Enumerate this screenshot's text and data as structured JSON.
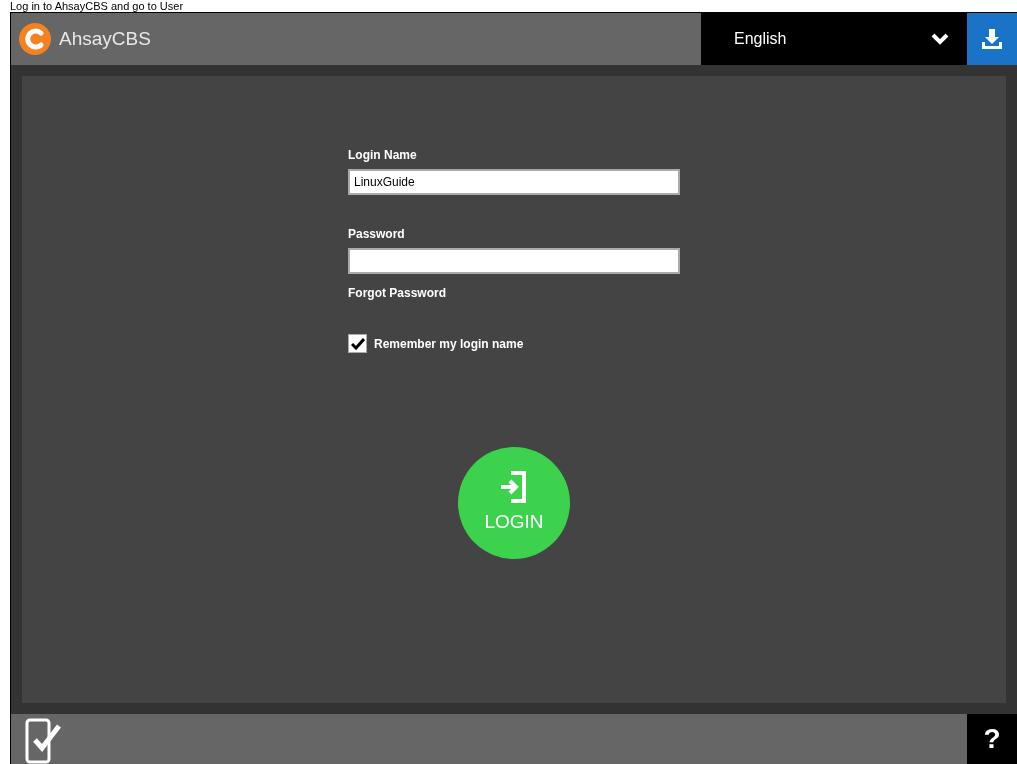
{
  "caption": "Log in to AhsayCBS and go to User",
  "header": {
    "brand": "AhsayCBS",
    "language": "English"
  },
  "form": {
    "login_name": {
      "label": "Login Name",
      "value": "LinuxGuide"
    },
    "password": {
      "label": "Password"
    },
    "forgot_link": "Forgot Password",
    "remember": {
      "label": "Remember my login name",
      "checked": true
    },
    "login_button": "LOGIN"
  },
  "footer": {
    "help": "?"
  }
}
